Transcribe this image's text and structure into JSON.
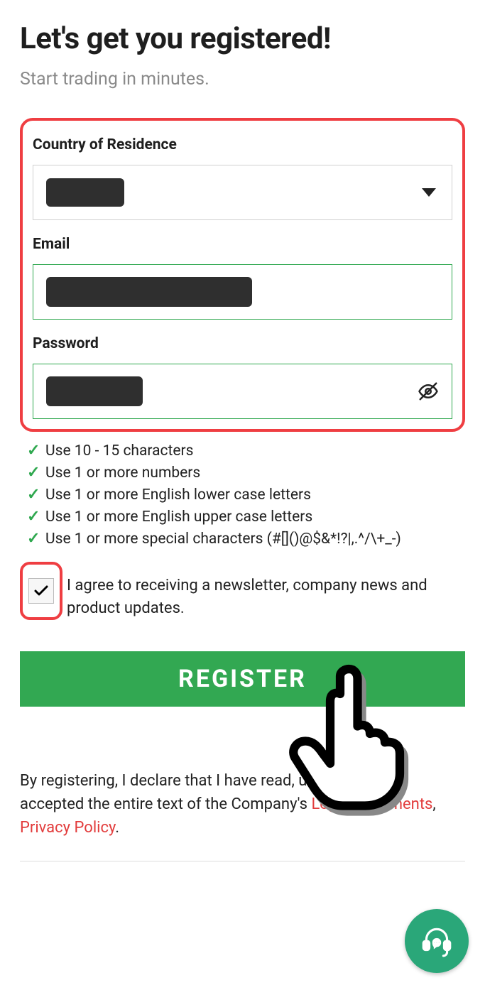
{
  "header": {
    "title": "Let's get you registered!",
    "subtitle": "Start trading in minutes."
  },
  "form": {
    "country": {
      "label": "Country of Residence"
    },
    "email": {
      "label": "Email"
    },
    "password": {
      "label": "Password"
    }
  },
  "password_rules": [
    "Use 10 - 15 characters",
    "Use 1 or more numbers",
    "Use 1 or more English lower case letters",
    "Use 1 or more English upper case letters",
    "Use 1 or more special characters (#[]()@$&*!?|,.^/\\+_-)"
  ],
  "newsletter": {
    "text": "I agree to receiving a newsletter, company news and product updates."
  },
  "actions": {
    "register": "REGISTER"
  },
  "declaration": {
    "prefix": "By registering, I declare that I have read, understood and accepted the entire text of the Company's ",
    "legal": "Legal Documents",
    "sep": ", ",
    "privacy": "Privacy Policy",
    "suffix": "."
  }
}
